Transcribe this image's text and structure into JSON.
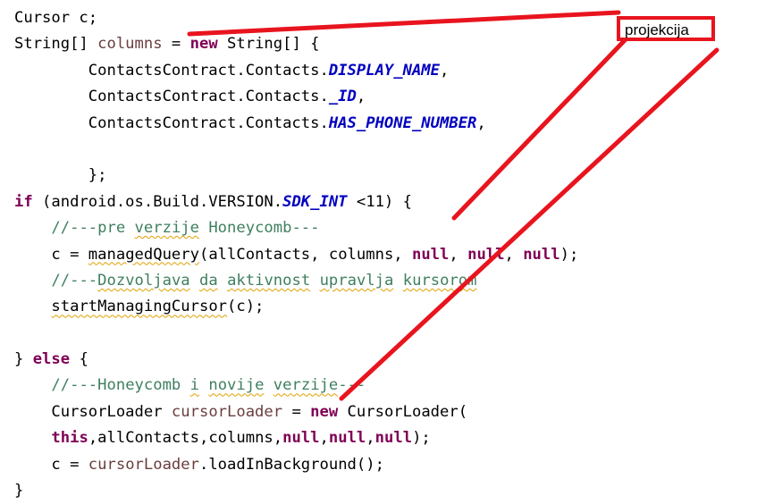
{
  "lines": [
    {
      "p": [
        {
          "t": "Cursor c;"
        }
      ]
    },
    {
      "p": [
        {
          "t": "String[] "
        },
        {
          "t": "columns",
          "c": "var"
        },
        {
          "t": " = "
        },
        {
          "t": "new",
          "c": "kw"
        },
        {
          "t": " String[] {"
        }
      ]
    },
    {
      "p": [
        {
          "t": "        ContactsContract.Contacts."
        },
        {
          "t": "DISPLAY_NAME",
          "c": "cst"
        },
        {
          "t": ","
        }
      ]
    },
    {
      "p": [
        {
          "t": "        ContactsContract.Contacts."
        },
        {
          "t": "_ID",
          "c": "cst"
        },
        {
          "t": ","
        }
      ]
    },
    {
      "p": [
        {
          "t": "        ContactsContract.Contacts."
        },
        {
          "t": "HAS_PHONE_NUMBER",
          "c": "cst"
        },
        {
          "t": ","
        }
      ]
    },
    {
      "p": []
    },
    {
      "p": [
        {
          "t": "        };"
        }
      ]
    },
    {
      "p": [
        {
          "t": "if",
          "c": "kw"
        },
        {
          "t": " (android.os.Build.VERSION."
        },
        {
          "t": "SDK_INT",
          "c": "cst"
        },
        {
          "t": " <11) {"
        }
      ]
    },
    {
      "p": [
        {
          "t": "    "
        },
        {
          "t": "//---pre ",
          "c": "cmt"
        },
        {
          "t": "verzije",
          "c": "cmt sq"
        },
        {
          "t": " Honeycomb---",
          "c": "cmt"
        }
      ]
    },
    {
      "p": [
        {
          "t": "    c = "
        },
        {
          "t": "managedQuery",
          "c": "depr sq"
        },
        {
          "t": "(allContacts, columns, "
        },
        {
          "t": "null",
          "c": "kw"
        },
        {
          "t": ", "
        },
        {
          "t": "null",
          "c": "kw"
        },
        {
          "t": ", "
        },
        {
          "t": "null",
          "c": "kw"
        },
        {
          "t": ");"
        }
      ]
    },
    {
      "p": [
        {
          "t": "    "
        },
        {
          "t": "//---",
          "c": "cmt"
        },
        {
          "t": "Dozvoljava",
          "c": "cmt sq"
        },
        {
          "t": " ",
          "c": "cmt"
        },
        {
          "t": "da",
          "c": "cmt sq"
        },
        {
          "t": " ",
          "c": "cmt"
        },
        {
          "t": "aktivnost",
          "c": "cmt sq"
        },
        {
          "t": " ",
          "c": "cmt"
        },
        {
          "t": "upravlja",
          "c": "cmt sq"
        },
        {
          "t": " ",
          "c": "cmt"
        },
        {
          "t": "kursorom",
          "c": "cmt sq"
        }
      ]
    },
    {
      "p": [
        {
          "t": "    "
        },
        {
          "t": "startManagingCursor",
          "c": "depr sq"
        },
        {
          "t": "(c);"
        }
      ]
    },
    {
      "p": []
    },
    {
      "p": [
        {
          "t": "} "
        },
        {
          "t": "else",
          "c": "kw"
        },
        {
          "t": " {"
        }
      ]
    },
    {
      "p": [
        {
          "t": "    "
        },
        {
          "t": "//---Honeycomb ",
          "c": "cmt"
        },
        {
          "t": "i",
          "c": "cmt sq"
        },
        {
          "t": " ",
          "c": "cmt"
        },
        {
          "t": "novije",
          "c": "cmt sq"
        },
        {
          "t": " ",
          "c": "cmt"
        },
        {
          "t": "verzije",
          "c": "cmt sq"
        },
        {
          "t": "---",
          "c": "cmt"
        }
      ]
    },
    {
      "p": [
        {
          "t": "    CursorLoader "
        },
        {
          "t": "cursorLoader",
          "c": "var"
        },
        {
          "t": " = "
        },
        {
          "t": "new",
          "c": "kw"
        },
        {
          "t": " CursorLoader("
        }
      ]
    },
    {
      "p": [
        {
          "t": "    "
        },
        {
          "t": "this",
          "c": "kw"
        },
        {
          "t": ",allContacts,columns,"
        },
        {
          "t": "null",
          "c": "kw"
        },
        {
          "t": ","
        },
        {
          "t": "null",
          "c": "kw"
        },
        {
          "t": ","
        },
        {
          "t": "null",
          "c": "kw"
        },
        {
          "t": ");"
        }
      ]
    },
    {
      "p": [
        {
          "t": "    c = "
        },
        {
          "t": "cursorLoader",
          "c": "var"
        },
        {
          "t": ".loadInBackground();"
        }
      ]
    },
    {
      "p": [
        {
          "t": "}"
        }
      ]
    }
  ],
  "annotation": {
    "label": "projekcija",
    "color": "#e8141e"
  }
}
